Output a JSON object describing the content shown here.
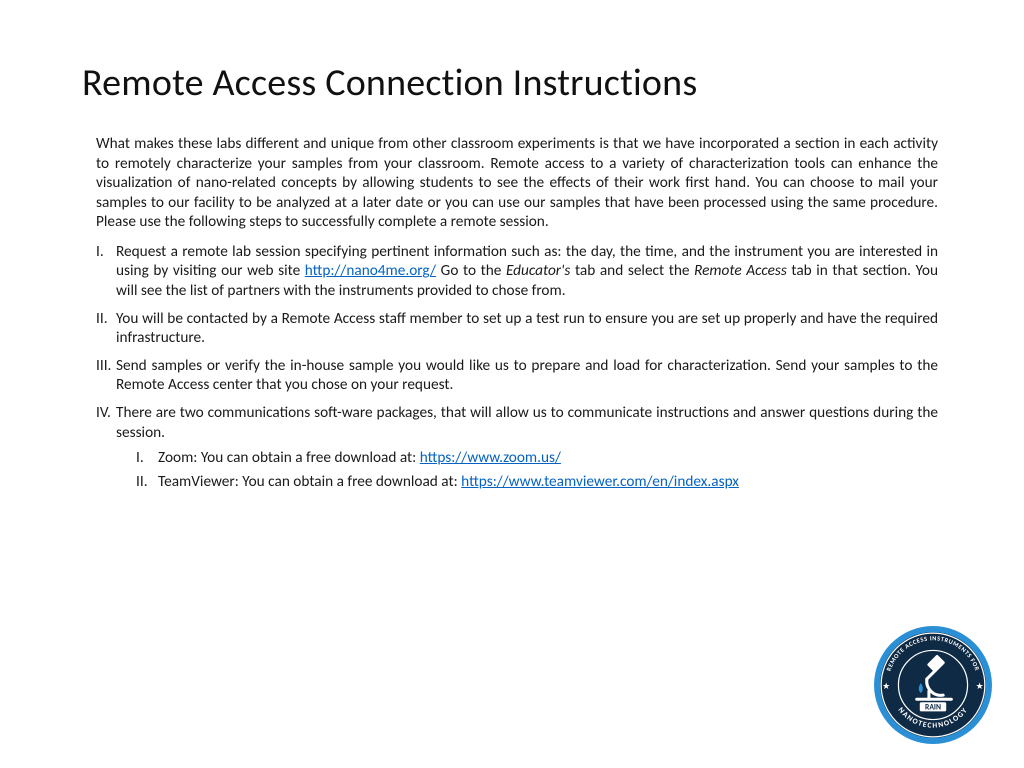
{
  "title": "Remote Access Connection Instructions",
  "intro": "What makes these labs different and unique from other classroom experiments is that we have incorporated a section in each activity to remotely characterize your samples from your classroom. Remote access to a variety of characterization tools can enhance the visualization of nano-related concepts by allowing students to see the effects of their work first hand. You can choose to mail your samples to our facility to be analyzed at a later date or you can use our samples that have been processed using the same procedure. Please use the following steps to successfully complete a remote session.",
  "steps": {
    "i": {
      "num": "I.",
      "pre": "Request a remote lab session specifying pertinent information such as: the day, the time, and the instrument you are interested in using by visiting our web site ",
      "link": "http://nano4me.org/",
      "mid": "  Go to the ",
      "tab1": "Educator's",
      "mid2": " tab and select the ",
      "tab2": "Remote Access",
      "post": " tab in that section. You will see the list of partners with the instruments provided to chose from."
    },
    "ii": {
      "num": "II.",
      "text": "You will be contacted by a Remote Access staff member to set up a test run to ensure you are set up properly and have the required infrastructure."
    },
    "iii": {
      "num": "III.",
      "text": "Send samples or verify the in-house sample you would like us to prepare and load for characterization. Send your samples to the Remote Access center that you chose on your request."
    },
    "iv": {
      "num": "IV.",
      "text": "There are two communications soft-ware packages, that will allow us to communicate instructions and answer questions during the session.",
      "sub": {
        "i": {
          "num": "I.",
          "pre": "Zoom: You can obtain a free download at: ",
          "link": "https://www.zoom.us/"
        },
        "ii": {
          "num": "II.",
          "pre": "TeamViewer: You can obtain a free download at: ",
          "link": "https://www.teamviewer.com/en/index.aspx"
        }
      }
    }
  },
  "badge": {
    "top_text": "REMOTE ACCESS INSTRUMENTS FOR",
    "bottom_text": "NANOTECHNOLOGY",
    "center_label": "RAIN",
    "ring_color": "#2a8fd4",
    "inner_color": "#0f2a44",
    "stroke_color": "#ffffff"
  }
}
